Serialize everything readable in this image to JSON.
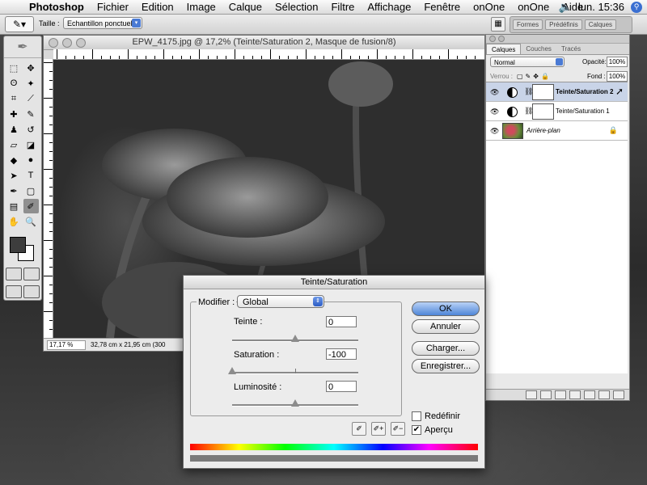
{
  "menubar": {
    "apple": "",
    "items": [
      "Photoshop",
      "Fichier",
      "Edition",
      "Image",
      "Calque",
      "Sélection",
      "Filtre",
      "Affichage",
      "Fenêtre",
      "onOne",
      "onOne",
      "Aide"
    ],
    "clock": "lun. 15:36",
    "volume_icon": "volume-icon",
    "spotlight_icon": "spotlight-icon"
  },
  "options": {
    "taille_label": "Taille :",
    "taille_value": "Echantillon ponctuel",
    "palette_well_tabs": [
      "Formes",
      "Prédéfinis",
      "Calques"
    ]
  },
  "document": {
    "title": "EPW_4175.jpg @ 17,2% (Teinte/Saturation 2, Masque de fusion/8)",
    "zoom": "17,17 %",
    "info": "32,78 cm x 21,95 cm (300"
  },
  "layers_panel": {
    "tabs": [
      "Calques",
      "Couches",
      "Tracés"
    ],
    "blend_mode": "Normal",
    "opacity_label": "Opacité:",
    "opacity_value": "100%",
    "lock_label": "Verrou :",
    "fill_label": "Fond :",
    "fill_value": "100%",
    "layers": [
      {
        "name": "Teinte/Saturation 2",
        "selected": true
      },
      {
        "name": "Teinte/Saturation 1",
        "selected": false
      },
      {
        "name": "Arrière-plan",
        "selected": false
      }
    ]
  },
  "dialog": {
    "title": "Teinte/Saturation",
    "modifier_label": "Modifier :",
    "modifier_value": "Global",
    "teinte_label": "Teinte :",
    "teinte_value": "0",
    "saturation_label": "Saturation :",
    "saturation_value": "-100",
    "luminosite_label": "Luminosité :",
    "luminosite_value": "0",
    "ok": "OK",
    "annuler": "Annuler",
    "charger": "Charger...",
    "enregistrer": "Enregistrer...",
    "redefinir": "Redéfinir",
    "apercu": "Aperçu",
    "apercu_checked": true,
    "redefinir_checked": false
  }
}
